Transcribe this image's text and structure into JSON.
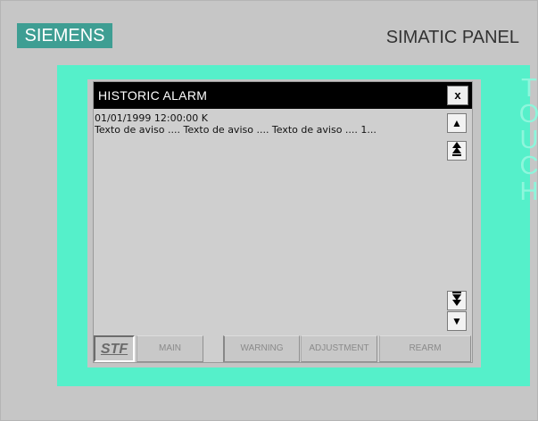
{
  "header": {
    "brand": "SIEMENS",
    "product": "SIMATIC PANEL",
    "touch_label": "TOUCH"
  },
  "window": {
    "title": "HISTORIC ALARM",
    "close_label": "x"
  },
  "alarms": [
    {
      "timestamp": "01/01/1999 12:00:00 K",
      "text": "Texto de aviso .... Texto de aviso .... Texto de aviso .... 1..."
    }
  ],
  "scroll": {
    "up_glyph": "▲",
    "top_glyph": "⯭",
    "bottom_glyph": "⯯",
    "down_glyph": "▼"
  },
  "buttons": {
    "logo": "STF",
    "main": "MAIN",
    "warning": "WARNING",
    "adjustment": "ADJUSTMENT",
    "rearm": "REARM"
  },
  "colors": {
    "bezel": "#55f0ca",
    "brand_bg": "#3e9e93",
    "titlebar": "#000000",
    "screen_bg": "#c4c4c4"
  }
}
